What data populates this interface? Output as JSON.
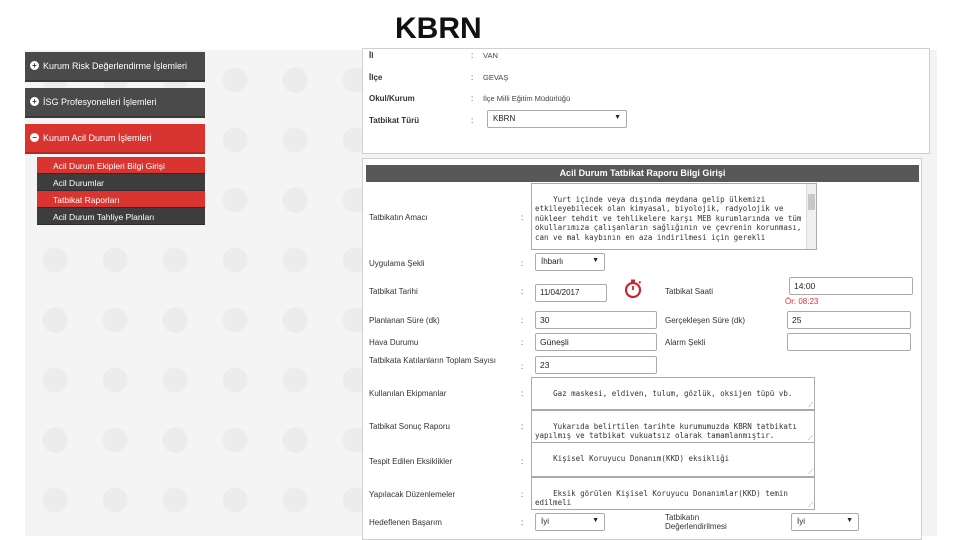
{
  "slide": {
    "title": "KBRN"
  },
  "sidebar": {
    "items": [
      {
        "label": "Kurum Risk Değerlendirme İşlemleri",
        "active": false
      },
      {
        "label": "İSG Profesyonelleri İşlemleri",
        "active": false
      },
      {
        "label": "Kurum Acil Durum İşlemleri",
        "active": true
      }
    ],
    "sub_items": [
      {
        "label": "Acil Durum Ekipleri Bilgi Girişi",
        "active": true
      },
      {
        "label": "Acil Durumlar",
        "active": false
      },
      {
        "label": "Tatbikat Raporları",
        "active": true
      },
      {
        "label": "Acil Durum Tahliye Planları",
        "active": false
      }
    ]
  },
  "top_panel": {
    "il_label": "İl",
    "il_value": "VAN",
    "ilce_label": "İlçe",
    "ilce_value": "GEVAŞ",
    "okul_label": "Okul/Kurum",
    "okul_value": "İlçe Milli Eğitim Müdürlüğü",
    "tur_label": "Tatbikat Türü",
    "tur_value": "KBRN",
    "colon": ":"
  },
  "form": {
    "header": "Acil Durum Tatbikat Raporu Bilgi Girişi",
    "colon": ":",
    "amac_label": "Tatbikatın Amacı",
    "amac_value": "Yurt içinde veya dışında meydana gelip ülkemizi etkileyebilecek olan kimyasal, biyolojik, radyolojik ve nükleer tehdit ve tehlikelere karşı MEB kurumlarında ve tüm okullarımıza çalışanların sağlığının ve çevrenin korunması, can ve mal kaybının en aza indirilmesi için gerekli",
    "sekil_label": "Uygulama Şekli",
    "sekil_value": "İhbarlı",
    "tarih_label": "Tatbikat Tarihi",
    "tarih_value": "11/04/2017",
    "saat_label": "Tatbikat Saati",
    "saat_value": "14:00",
    "saat_hint": "Ör: 08:23",
    "planlanan_label": "Planlanan Süre (dk)",
    "planlanan_value": "30",
    "gerceklesen_label": "Gerçekleşen Süre (dk)",
    "gerceklesen_value": "25",
    "hava_label": "Hava Durumu",
    "hava_value": "Güneşli",
    "alarm_label": "Alarm Şekli",
    "alarm_value": "",
    "katilan_label": "Tatbikata Katılanların Toplam Sayısı",
    "katilan_value": "23",
    "ekipman_label": "Kullanılan Ekipmanlar",
    "ekipman_value": "Gaz maskesi, eldiven, tulum, gözlük, oksijen tüpü vb.",
    "sonuc_label": "Tatbikat Sonuç Raporu",
    "sonuc_value": "Yukarıda belirtilen tarihte kurumumuzda KBRN tatbikatı yapılmış ve tatbikat vukuatsız olarak tamamlanmıştır.",
    "eksik_label": "Tespit Edilen Eksiklikler",
    "eksik_value": "Kişisel Koruyucu Donanım(KKD) eksikliği",
    "duzen_label": "Yapılacak Düzenlemeler",
    "duzen_value": "Eksik görülen Kişisel Koruyucu Donanımlar(KKD) temin edilmeli",
    "basari_label": "Hedeflenen Başarım",
    "basari_value": "İyi",
    "deger_label": "Tatbikatın Değerlendirilmesi",
    "deger_value": "İyi"
  },
  "icons": {
    "bullet": "plus-circle-icon",
    "clock": "stopwatch-icon",
    "arrow": "chevron-down-icon"
  },
  "colors": {
    "accent": "#d9342f",
    "menu": "#4a4a4a",
    "header": "#585858"
  }
}
